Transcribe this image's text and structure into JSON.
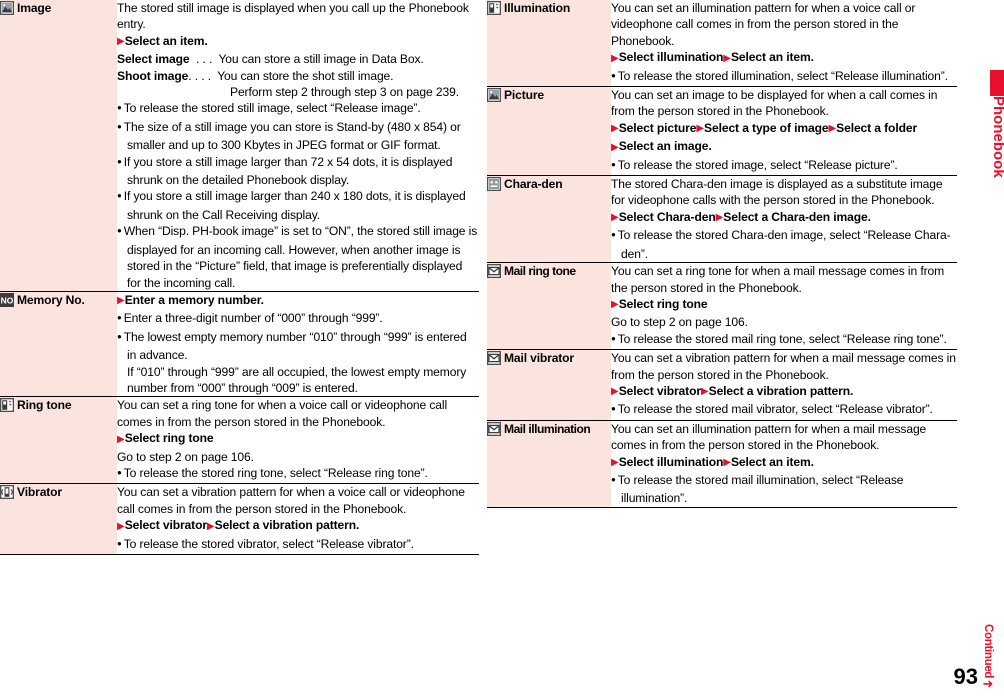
{
  "page": {
    "number": "93",
    "edge_tab_label": "Phonebook",
    "continued_label": "Continued",
    "continued_arrow": "➜",
    "accent_color": "#e8112d",
    "label_column_color": "#fce4de"
  },
  "left_column": {
    "rows": [
      {
        "icon": "picture-landscape-icon",
        "label": "Image",
        "lines": [
          {
            "type": "plain",
            "text": "The stored still image is displayed when you call up the Phonebook entry."
          },
          {
            "type": "action",
            "segments": [
              "Select an item."
            ]
          },
          {
            "type": "option",
            "term": "Select image",
            "dots": "  . . .  ",
            "text": "You can store a still image in Data Box."
          },
          {
            "type": "option",
            "term": "Shoot image",
            ".": "",
            "dots": ". . . .  ",
            "text": "You can store the shot still image."
          },
          {
            "type": "deep",
            "text": "Perform step 2 through step 3 on page 239."
          },
          {
            "type": "bullet",
            "text": "To release the stored still image, select “Release image”."
          },
          {
            "type": "bullet",
            "text": "The size of a still image you can store is Stand-by (480 x 854) or smaller and up to 300 Kbytes in JPEG format or GIF format."
          },
          {
            "type": "bullet",
            "text": "If you store a still image larger than 72 x 54 dots, it is displayed shrunk on the detailed Phonebook display."
          },
          {
            "type": "bullet",
            "text": "If you store a still image larger than 240 x 180 dots, it is displayed shrunk on the Call Receiving display."
          },
          {
            "type": "bullet",
            "text": "When “Disp. PH-book image” is set to “ON”, the stored still image is displayed for an incoming call. However, when another image is stored in the “Picture” field, that image is preferentially displayed for the incoming call."
          }
        ]
      },
      {
        "icon": "memory-no-icon",
        "label": "Memory No.",
        "lines": [
          {
            "type": "action",
            "segments": [
              "Enter a memory number."
            ]
          },
          {
            "type": "bullet",
            "text": "Enter a three-digit number of “000” through “999”."
          },
          {
            "type": "bullet",
            "text": "The lowest empty memory number “010” through “999” is entered in advance."
          },
          {
            "type": "hang",
            "text": "If “010” through “999” are all occupied, the lowest empty memory number from “000” through “009” is entered."
          }
        ]
      },
      {
        "icon": "ring-tone-icon",
        "label": "Ring tone",
        "lines": [
          {
            "type": "plain",
            "text": "You can set a ring tone for when a voice call or videophone call comes in from the person stored in the Phonebook."
          },
          {
            "type": "action",
            "segments": [
              "Select ring tone"
            ]
          },
          {
            "type": "plain",
            "text": "Go to step 2 on page 106."
          },
          {
            "type": "bullet",
            "text": "To release the stored ring tone, select “Release ring tone”."
          }
        ]
      },
      {
        "icon": "vibrator-icon",
        "label": "Vibrator",
        "lines": [
          {
            "type": "plain",
            "text": "You can set a vibration pattern for when a voice call or videophone call comes in from the person stored in the Phonebook."
          },
          {
            "type": "action",
            "segments": [
              "Select vibrator",
              "Select a vibration pattern."
            ]
          },
          {
            "type": "bullet",
            "text": "To release the stored vibrator, select “Release vibrator”."
          }
        ]
      }
    ]
  },
  "right_column": {
    "rows": [
      {
        "icon": "illumination-icon",
        "label": "Illumination",
        "lines": [
          {
            "type": "plain",
            "text": "You can set an illumination pattern for when a voice call or videophone call comes in from the person stored in the Phonebook."
          },
          {
            "type": "action",
            "segments": [
              "Select illumination",
              "Select an item."
            ]
          },
          {
            "type": "bullet",
            "text": "To release the stored illumination, select “Release illumination”."
          }
        ]
      },
      {
        "icon": "picture-icon",
        "label": "Picture",
        "lines": [
          {
            "type": "plain",
            "text": "You can set an image to be displayed for when a call comes in from the person stored in the Phonebook."
          },
          {
            "type": "action",
            "segments": [
              "Select picture",
              "Select a type of image",
              "Select a folder"
            ]
          },
          {
            "type": "action",
            "segments": [
              "Select an image."
            ]
          },
          {
            "type": "bullet",
            "text": "To release the stored image, select “Release picture”."
          }
        ]
      },
      {
        "icon": "chara-den-icon",
        "label": "Chara-den",
        "lines": [
          {
            "type": "plain",
            "text": "The stored Chara-den image is displayed as a substitute image for videophone calls with the person stored in the Phonebook."
          },
          {
            "type": "action",
            "segments": [
              "Select Chara-den",
              "Select a Chara-den image."
            ]
          },
          {
            "type": "bullet",
            "text": "To release the stored Chara-den image, select “Release Chara-den”."
          }
        ]
      },
      {
        "icon": "mail-ring-tone-icon",
        "label": "Mail ring tone",
        "lines": [
          {
            "type": "plain",
            "text": "You can set a ring tone for when a mail message comes in from the person stored in the Phonebook."
          },
          {
            "type": "action",
            "segments": [
              "Select ring tone"
            ]
          },
          {
            "type": "plain",
            "text": "Go to step 2 on page 106."
          },
          {
            "type": "bullet",
            "text": "To release the stored mail ring tone, select “Release ring tone”."
          }
        ]
      },
      {
        "icon": "mail-vibrator-icon",
        "label": "Mail vibrator",
        "lines": [
          {
            "type": "plain",
            "text": "You can set a vibration pattern for when a mail message comes in from the person stored in the Phonebook."
          },
          {
            "type": "action",
            "segments": [
              "Select vibrator",
              "Select a vibration pattern."
            ]
          },
          {
            "type": "bullet",
            "text": "To release the stored mail vibrator, select “Release vibrator”."
          }
        ]
      },
      {
        "icon": "mail-illumination-icon",
        "label": "Mail illumination",
        "lines": [
          {
            "type": "plain",
            "text": "You can set an illumination pattern for when a mail message comes in from the person stored in the Phonebook."
          },
          {
            "type": "action",
            "segments": [
              "Select illumination",
              "Select an item."
            ]
          },
          {
            "type": "bullet",
            "text": "To release the stored mail illumination, select “Release illumination”."
          }
        ]
      }
    ]
  }
}
